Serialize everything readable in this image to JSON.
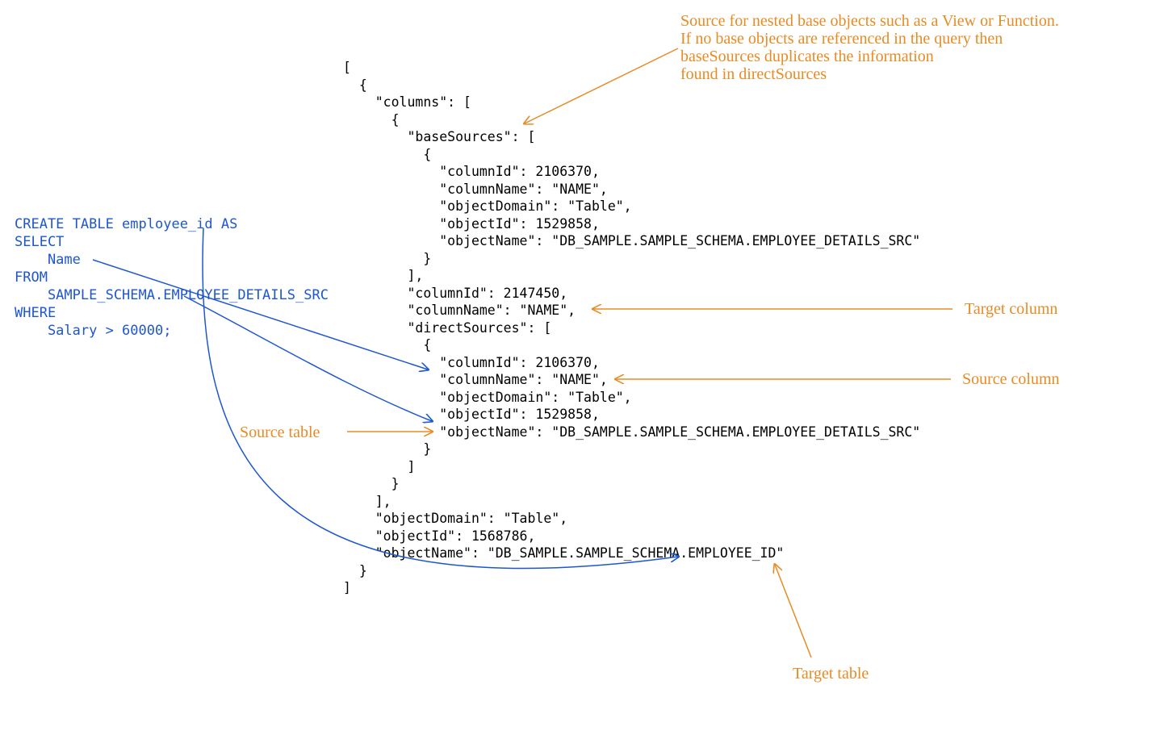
{
  "sql": {
    "line1": "CREATE TABLE employee_id AS",
    "line2": "SELECT",
    "line3": "    Name",
    "line4": "FROM",
    "line5": "    SAMPLE_SCHEMA.EMPLOYEE_DETAILS_SRC",
    "line6": "WHERE",
    "line7": "    Salary > 60000;"
  },
  "json_lines": {
    "l0": "[",
    "l1": "  {",
    "l2": "    \"columns\": [",
    "l3": "      {",
    "l4": "        \"baseSources\": [",
    "l5": "          {",
    "l6": "            \"columnId\": 2106370,",
    "l7": "            \"columnName\": \"NAME\",",
    "l8": "            \"objectDomain\": \"Table\",",
    "l9": "            \"objectId\": 1529858,",
    "l10": "            \"objectName\": \"DB_SAMPLE.SAMPLE_SCHEMA.EMPLOYEE_DETAILS_SRC\"",
    "l11": "          }",
    "l12": "        ],",
    "l13": "        \"columnId\": 2147450,",
    "l14": "        \"columnName\": \"NAME\",",
    "l15": "        \"directSources\": [",
    "l16": "          {",
    "l17": "            \"columnId\": 2106370,",
    "l18": "            \"columnName\": \"NAME\",",
    "l19": "            \"objectDomain\": \"Table\",",
    "l20": "            \"objectId\": 1529858,",
    "l21": "            \"objectName\": \"DB_SAMPLE.SAMPLE_SCHEMA.EMPLOYEE_DETAILS_SRC\"",
    "l22": "          }",
    "l23": "        ]",
    "l24": "      }",
    "l25": "    ],",
    "l26": "    \"objectDomain\": \"Table\",",
    "l27": "    \"objectId\": 1568786,",
    "l28": "    \"objectName\": \"DB_SAMPLE.SAMPLE_SCHEMA.EMPLOYEE_ID\"",
    "l29": "  }",
    "l30": "]"
  },
  "notes": {
    "basesources": "Source for nested base objects such as a View or Function.\nIf no base objects are referenced in the query then\nbaseSources duplicates the information\nfound in directSources",
    "target_column": "Target column",
    "source_column": "Source column",
    "source_table": "Source table",
    "target_table": "Target table"
  }
}
